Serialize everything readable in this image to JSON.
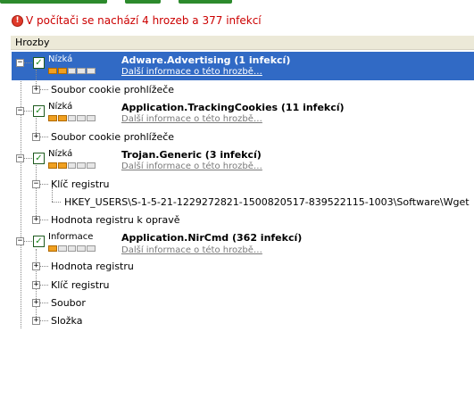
{
  "summary": {
    "text": "V počítači se nachází 4 hrozeb a 377 infekcí"
  },
  "header": {
    "column": "Hrozby"
  },
  "threats": [
    {
      "severity": "Nízká",
      "level": 0.4,
      "name": "Adware.Advertising (1 infekcí)",
      "link": "Další informace o této hrozbě…",
      "selected": true,
      "children": [
        {
          "label": "Soubor cookie prohlížeče"
        }
      ]
    },
    {
      "severity": "Nízká",
      "level": 0.4,
      "name": "Application.TrackingCookies (11 infekcí)",
      "link": "Další informace o této hrozbě…",
      "selected": false,
      "children": [
        {
          "label": "Soubor cookie prohlížeče"
        }
      ]
    },
    {
      "severity": "Nízká",
      "level": 0.4,
      "name": "Trojan.Generic (3 infekcí)",
      "link": "Další informace o této hrozbě…",
      "selected": false,
      "children": [
        {
          "label": "Klíč registru",
          "expanded": true,
          "children": [
            {
              "label": "HKEY_USERS\\S-1-5-21-1229272821-1500820517-839522115-1003\\Software\\Wget"
            }
          ]
        },
        {
          "label": "Hodnota registru k opravě"
        }
      ]
    },
    {
      "severity": "Informace",
      "level": 0.2,
      "name": "Application.NirCmd (362 infekcí)",
      "link": "Další informace o této hrozbě…",
      "selected": false,
      "children": [
        {
          "label": "Hodnota registru"
        },
        {
          "label": "Klíč registru"
        },
        {
          "label": "Soubor"
        },
        {
          "label": "Složka"
        }
      ]
    }
  ]
}
